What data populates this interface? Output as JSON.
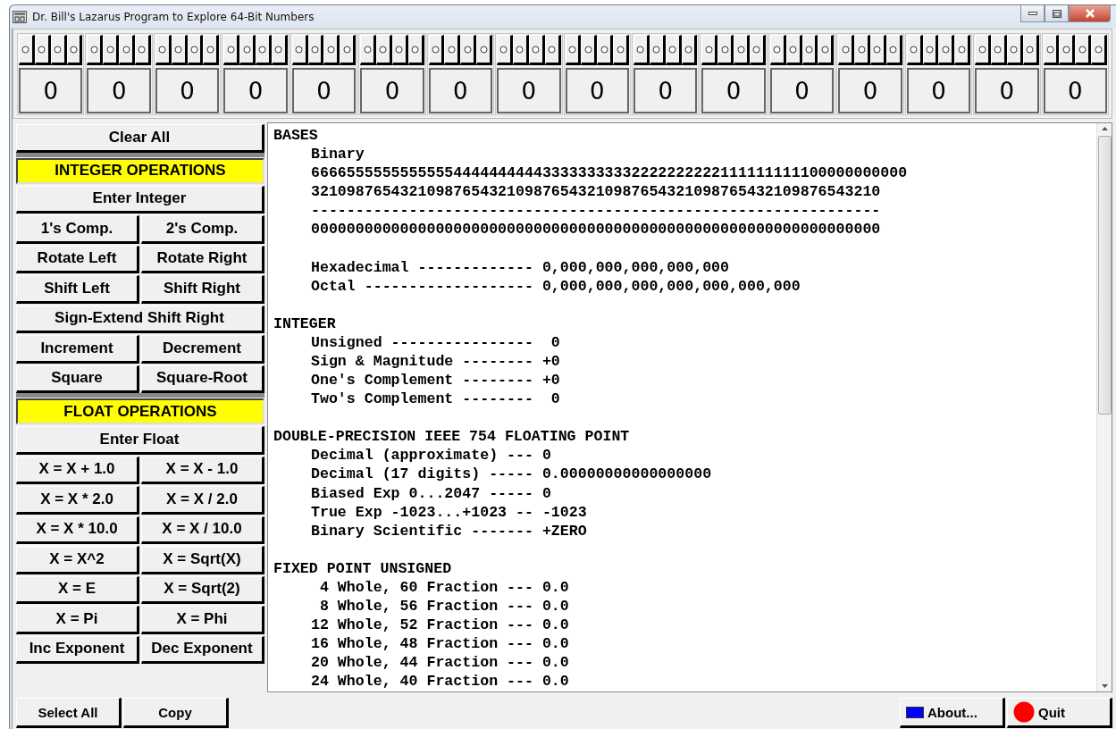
{
  "window": {
    "title": "Dr. Bill's Lazarus Program to Explore 64-Bit Numbers"
  },
  "nibbles": [
    {
      "digit": "0",
      "bits": [
        {
          "on": false
        },
        {
          "on": false
        },
        {
          "on": false
        },
        {
          "on": false
        }
      ]
    },
    {
      "digit": "0",
      "bits": [
        {
          "on": false
        },
        {
          "on": false
        },
        {
          "on": false
        },
        {
          "on": false
        }
      ]
    },
    {
      "digit": "0",
      "bits": [
        {
          "on": false
        },
        {
          "on": false
        },
        {
          "on": false
        },
        {
          "on": false
        }
      ]
    },
    {
      "digit": "0",
      "bits": [
        {
          "on": false
        },
        {
          "on": false
        },
        {
          "on": false
        },
        {
          "on": false
        }
      ]
    },
    {
      "digit": "0",
      "bits": [
        {
          "on": false
        },
        {
          "on": false
        },
        {
          "on": false
        },
        {
          "on": false
        }
      ]
    },
    {
      "digit": "0",
      "bits": [
        {
          "on": false
        },
        {
          "on": false
        },
        {
          "on": false
        },
        {
          "on": false
        }
      ]
    },
    {
      "digit": "0",
      "bits": [
        {
          "on": false
        },
        {
          "on": false
        },
        {
          "on": false
        },
        {
          "on": false
        }
      ]
    },
    {
      "digit": "0",
      "bits": [
        {
          "on": false
        },
        {
          "on": false
        },
        {
          "on": false
        },
        {
          "on": false
        }
      ]
    },
    {
      "digit": "0",
      "bits": [
        {
          "on": false
        },
        {
          "on": false
        },
        {
          "on": false
        },
        {
          "on": false
        }
      ]
    },
    {
      "digit": "0",
      "bits": [
        {
          "on": false
        },
        {
          "on": false
        },
        {
          "on": false
        },
        {
          "on": false
        }
      ]
    },
    {
      "digit": "0",
      "bits": [
        {
          "on": false
        },
        {
          "on": false
        },
        {
          "on": false
        },
        {
          "on": false
        }
      ]
    },
    {
      "digit": "0",
      "bits": [
        {
          "on": false
        },
        {
          "on": false
        },
        {
          "on": false
        },
        {
          "on": false
        }
      ]
    },
    {
      "digit": "0",
      "bits": [
        {
          "on": false
        },
        {
          "on": false
        },
        {
          "on": false
        },
        {
          "on": false
        }
      ]
    },
    {
      "digit": "0",
      "bits": [
        {
          "on": false
        },
        {
          "on": false
        },
        {
          "on": false
        },
        {
          "on": false
        }
      ]
    },
    {
      "digit": "0",
      "bits": [
        {
          "on": false
        },
        {
          "on": false
        },
        {
          "on": false
        },
        {
          "on": false
        }
      ]
    },
    {
      "digit": "0",
      "bits": [
        {
          "on": false
        },
        {
          "on": false
        },
        {
          "on": false
        },
        {
          "on": false
        }
      ]
    }
  ],
  "operations": [
    {
      "kind": "button",
      "label": "Clear All"
    },
    {
      "kind": "separator"
    },
    {
      "kind": "header",
      "label": "INTEGER OPERATIONS"
    },
    {
      "kind": "button",
      "label": "Enter Integer"
    },
    {
      "kind": "pair",
      "labels": [
        "1's Comp.",
        "2's Comp."
      ]
    },
    {
      "kind": "pair",
      "labels": [
        "Rotate Left",
        "Rotate Right"
      ]
    },
    {
      "kind": "pair",
      "labels": [
        "Shift Left",
        "Shift Right"
      ]
    },
    {
      "kind": "button",
      "label": "Sign-Extend Shift Right"
    },
    {
      "kind": "pair",
      "labels": [
        "Increment",
        "Decrement"
      ]
    },
    {
      "kind": "pair",
      "labels": [
        "Square",
        "Square-Root"
      ]
    },
    {
      "kind": "separator"
    },
    {
      "kind": "header",
      "label": "FLOAT OPERATIONS"
    },
    {
      "kind": "button",
      "label": "Enter Float"
    },
    {
      "kind": "pair",
      "labels": [
        "X = X + 1.0",
        "X = X - 1.0"
      ]
    },
    {
      "kind": "pair",
      "labels": [
        "X = X * 2.0",
        "X = X / 2.0"
      ]
    },
    {
      "kind": "pair",
      "labels": [
        "X = X * 10.0",
        "X = X / 10.0"
      ]
    },
    {
      "kind": "pair",
      "labels": [
        "X = X^2",
        "X = Sqrt(X)"
      ]
    },
    {
      "kind": "pair",
      "labels": [
        "X = E",
        "X = Sqrt(2)"
      ]
    },
    {
      "kind": "pair",
      "labels": [
        "X = Pi",
        "X = Phi"
      ]
    },
    {
      "kind": "pair",
      "labels": [
        "Inc Exponent",
        "Dec Exponent"
      ]
    }
  ],
  "output": {
    "sections": [
      {
        "heading": "BASES",
        "blocks": [
          [
            "Binary",
            "6666555555555555444444444433333333332222222222111111111100000000000",
            "3210987654321098765432109876543210987654321098765432109876543210",
            "----------------------------------------------------------------",
            "0000000000000000000000000000000000000000000000000000000000000000"
          ],
          [
            "Hexadecimal ------------- 0,000,000,000,000,000",
            "Octal ------------------- 0,000,000,000,000,000,000,000"
          ]
        ]
      },
      {
        "heading": "INTEGER",
        "blocks": [
          [
            "Unsigned ----------------  0",
            "Sign & Magnitude -------- +0",
            "One's Complement -------- +0",
            "Two's Complement --------  0"
          ]
        ]
      },
      {
        "heading": "DOUBLE-PRECISION IEEE 754 FLOATING POINT",
        "blocks": [
          [
            "Decimal (approximate) --- 0",
            "Decimal (17 digits) ----- 0.00000000000000000",
            "Biased Exp 0...2047 ----- 0",
            "True Exp -1023...+1023 -- -1023",
            "Binary Scientific ------- +ZERO"
          ]
        ]
      },
      {
        "heading": "FIXED POINT UNSIGNED",
        "blocks": [
          [
            " 4 Whole, 60 Fraction --- 0.0",
            " 8 Whole, 56 Fraction --- 0.0",
            "12 Whole, 52 Fraction --- 0.0",
            "16 Whole, 48 Fraction --- 0.0",
            "20 Whole, 44 Fraction --- 0.0",
            "24 Whole, 40 Fraction --- 0.0"
          ]
        ]
      }
    ]
  },
  "bottom_buttons": [
    {
      "kind": "plain",
      "label": "Select All"
    },
    {
      "kind": "plain",
      "label": "Copy"
    },
    {
      "kind": "spacer"
    },
    {
      "kind": "square",
      "label": "About...",
      "color": "#0000ff"
    },
    {
      "kind": "circle",
      "label": "Quit",
      "color": "#ff0000"
    }
  ]
}
